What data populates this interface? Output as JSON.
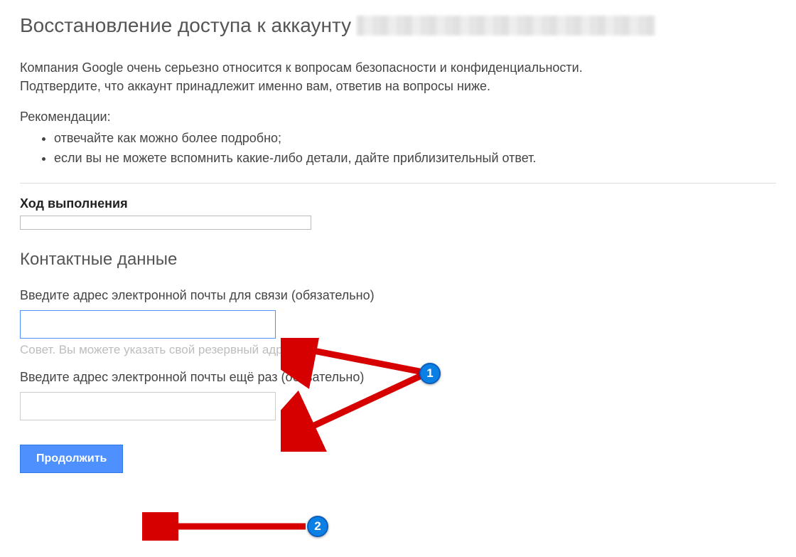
{
  "header": {
    "title": "Восстановление доступа к аккаунту"
  },
  "intro": {
    "line1": "Компания Google очень серьезно относится к вопросам безопасности и конфиденциальности.",
    "line2": "Подтвердите, что аккаунт принадлежит именно вам, ответив на вопросы ниже."
  },
  "recommendations": {
    "label": "Рекомендации:",
    "items": [
      "отвечайте как можно более подробно;",
      "если вы не можете вспомнить какие-либо детали, дайте приблизительный ответ."
    ]
  },
  "progress": {
    "label": "Ход выполнения"
  },
  "contact": {
    "heading": "Контактные данные",
    "email_label": "Введите адрес электронной почты для связи (обязательно)",
    "hint": "Совет. Вы можете указать свой резервный адрес.",
    "confirm_label": "Введите адрес электронной почты ещё раз (обязательно)"
  },
  "actions": {
    "continue_label": "Продолжить"
  },
  "annotations": {
    "badge1": "1",
    "badge2": "2"
  }
}
